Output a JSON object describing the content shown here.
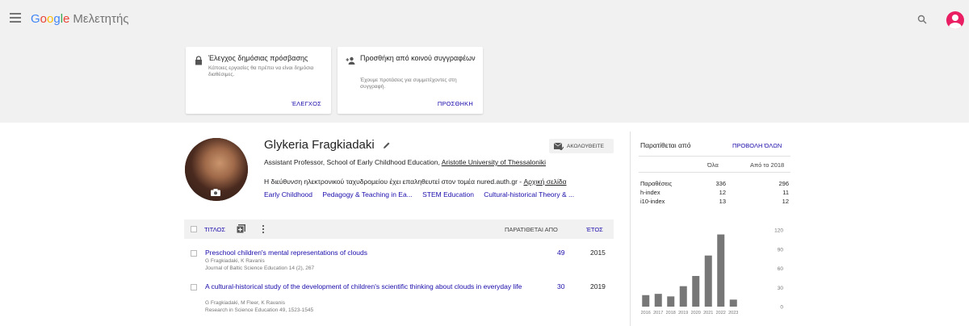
{
  "appbar": {
    "logo_parts": [
      "G",
      "o",
      "o",
      "g",
      "l",
      "e"
    ],
    "product": "Μελετητής",
    "menu_icon": "hamburger-icon",
    "search_icon": "search-icon",
    "account_icon": "account-avatar-icon"
  },
  "cards": [
    {
      "icon": "lock-icon",
      "title": "Έλεγχος δημόσιας πρόσβασης",
      "description": "Κάποιες εργασίες θα πρέπει να είναι δημόσια διαθέσιμες.",
      "action": "ΈΛΕΓΧΟΣ"
    },
    {
      "icon": "add-person-icon",
      "title": "Προσθήκη από κοινού συγγραφέων",
      "description": "Έχουμε προτάσεις για συμμετέχοντες στη συγγραφή.",
      "action": "ΠΡΟΣΘΗΚΗ"
    }
  ],
  "profile": {
    "name": "Glykeria Fragkiadaki",
    "affiliation_prefix": "Assistant Professor, School of Early Childhood Education, ",
    "affiliation_link": "Aristotle University of Thessaloniki",
    "email_text": "Η διεύθυνση ηλεκτρονικού ταχυδρομείου έχει επαληθευτεί στον τομέα nured.auth.gr - ",
    "homepage_link": "Αρχική σελίδα",
    "interests": [
      "Early Childhood",
      "Pedagogy & Teaching in Ea...",
      "STEM Education",
      "Cultural-historical Theory & ..."
    ],
    "follow_label": "ΑΚΟΛΟΥΘΕΙΤΕ"
  },
  "table": {
    "title_header": "ΤΙΤΛΟΣ",
    "cited_header": "ΠΑΡΑΤΙΘΕΤΑΙ ΑΠΟ",
    "year_header": "ΈΤΟΣ",
    "articles": [
      {
        "title": "Preschool children's mental representations of clouds",
        "authors": "G Fragkiadaki, K Ravanis",
        "venue": "Journal of Baltic Science Education 14 (2), 267",
        "cited": "49",
        "year": "2015"
      },
      {
        "title": "A cultural-historical study of the development of children's scientific thinking about clouds in everyday life",
        "authors": "G Fragkiadaki, M Fleer, K Ravanis",
        "venue": "Research in Science Education 49, 1523-1545",
        "cited": "30",
        "year": "2019"
      }
    ]
  },
  "cited_by": {
    "heading": "Παρατίθεται από",
    "view_all": "ΠΡΟΒΟΛΗ ΌΛΩΝ",
    "col_all": "Όλα",
    "col_since": "Από το 2018",
    "metrics": [
      {
        "label": "Παραθέσεις",
        "all": "336",
        "since": "296"
      },
      {
        "label": "h-index",
        "all": "12",
        "since": "11"
      },
      {
        "label": "i10-index",
        "all": "13",
        "since": "12"
      }
    ]
  },
  "chart_data": {
    "type": "bar",
    "categories": [
      "2016",
      "2017",
      "2018",
      "2019",
      "2020",
      "2021",
      "2022",
      "2023"
    ],
    "values": [
      18,
      20,
      16,
      32,
      48,
      80,
      113,
      11
    ],
    "ylim": [
      0,
      120
    ],
    "yticks": [
      "120",
      "90",
      "60",
      "30",
      "0"
    ],
    "bar_color": "#777777"
  },
  "colors": {
    "link": "#1a0dab",
    "header_bg": "#f1f1f1",
    "avatar_accent": "#e91e63"
  }
}
